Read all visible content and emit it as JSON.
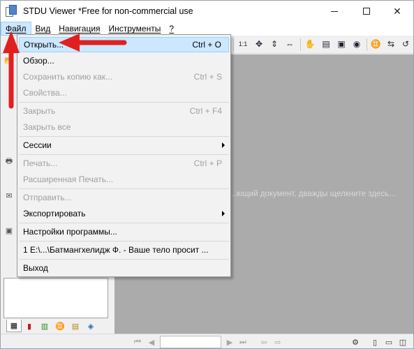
{
  "window": {
    "title": "STDU Viewer *Free for non-commercial use"
  },
  "menubar": {
    "items": [
      {
        "label": "Файл",
        "active": true
      },
      {
        "label": "Вид",
        "active": false
      },
      {
        "label": "Навигация",
        "active": false
      },
      {
        "label": "Инструменты",
        "active": false
      },
      {
        "label": "?",
        "active": false
      }
    ]
  },
  "file_menu": {
    "open": {
      "label": "Открыть...",
      "shortcut": "Ctrl + O"
    },
    "browse": {
      "label": "Обзор..."
    },
    "save_copy": {
      "label": "Сохранить копию как...",
      "shortcut": "Ctrl + S"
    },
    "properties": {
      "label": "Свойства..."
    },
    "close": {
      "label": "Закрыть",
      "shortcut": "Ctrl + F4"
    },
    "close_all": {
      "label": "Закрыть все"
    },
    "sessions": {
      "label": "Сессии"
    },
    "print": {
      "label": "Печать...",
      "shortcut": "Ctrl + P"
    },
    "ext_print": {
      "label": "Расширенная Печать..."
    },
    "send": {
      "label": "Отправить..."
    },
    "export": {
      "label": "Экспортировать"
    },
    "settings": {
      "label": "Настройки программы..."
    },
    "recent_1": {
      "label": "1 E:\\...\\Батмангхелидж Ф. - Ваше тело просит ..."
    },
    "exit": {
      "label": "Выход"
    }
  },
  "docarea": {
    "hint": "...ющий документ, дважды щелкните здесь..."
  },
  "toolbar": {
    "zoom_1to1_label": "1:1"
  },
  "colors": {
    "highlight": "#cce8ff",
    "annotation_arrow": "#e0201f",
    "doc_background": "#ababab"
  }
}
